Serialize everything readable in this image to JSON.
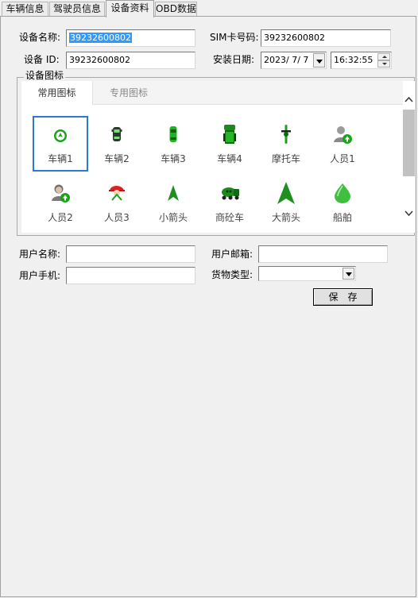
{
  "tabs": [
    {
      "label": "车辆信息"
    },
    {
      "label": "驾驶员信息"
    },
    {
      "label": "设备资料"
    },
    {
      "label": "OBD数据"
    }
  ],
  "device": {
    "name_label": "设备名称:",
    "name_value": "39232600802",
    "sim_label": "SIM卡号码:",
    "sim_value": "39232600802",
    "id_label": "设备 ID:",
    "id_value": "39232600802",
    "install_label": "安装日期:",
    "install_date": "2023/ 7/ 7",
    "install_time": "16:32:55"
  },
  "icons_group": {
    "title": "设备图标",
    "tabs": [
      {
        "label": "常用图标"
      },
      {
        "label": "专用图标"
      }
    ],
    "items": [
      {
        "label": "车辆1",
        "icon": "vehicle-circle-arrow-icon"
      },
      {
        "label": "车辆2",
        "icon": "car-topview-dark-icon"
      },
      {
        "label": "车辆3",
        "icon": "car-topview-green-icon"
      },
      {
        "label": "车辆4",
        "icon": "truck-topview-icon"
      },
      {
        "label": "摩托车",
        "icon": "motorcycle-icon"
      },
      {
        "label": "人员1",
        "icon": "person-arrow-icon"
      },
      {
        "label": "人员2",
        "icon": "person-female-arrow-icon"
      },
      {
        "label": "人员3",
        "icon": "person-red-cap-icon"
      },
      {
        "label": "小箭头",
        "icon": "small-arrow-icon"
      },
      {
        "label": "商砼车",
        "icon": "concrete-mixer-icon"
      },
      {
        "label": "大箭头",
        "icon": "big-arrow-icon"
      },
      {
        "label": "船舶",
        "icon": "ship-drop-icon"
      }
    ]
  },
  "user": {
    "name_label": "用户名称:",
    "name_value": "",
    "email_label": "用户邮箱:",
    "email_value": "",
    "phone_label": "用户手机:",
    "phone_value": "",
    "cargo_label": "货物类型:",
    "cargo_value": ""
  },
  "actions": {
    "save_label": "保存"
  },
  "colors": {
    "accent_blue": "#2a7ad5",
    "icon_green": "#1aa31a",
    "selection": "#3399ff"
  }
}
